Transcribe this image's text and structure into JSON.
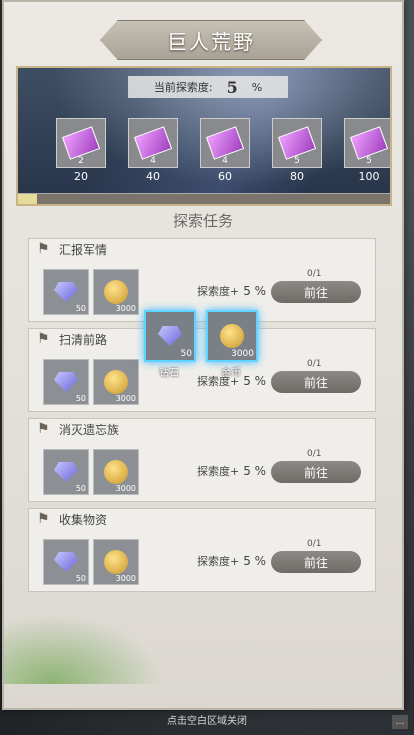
{
  "title": "巨人荒野",
  "explore": {
    "label": "当前探索度:",
    "value": "5",
    "unit": "%",
    "progress_fraction": 0.05
  },
  "milestones": [
    {
      "count": "2",
      "threshold": "20"
    },
    {
      "count": "4",
      "threshold": "40"
    },
    {
      "count": "4",
      "threshold": "60"
    },
    {
      "count": "5",
      "threshold": "80"
    },
    {
      "count": "5",
      "threshold": "100"
    }
  ],
  "section_title": "探索任务",
  "tasks": [
    {
      "name": "汇报军情",
      "gem_qty": "50",
      "coin_qty": "3000",
      "rate_label": "探索度+",
      "rate_value": "5 %",
      "progress": "0/1",
      "button": "前往"
    },
    {
      "name": "扫清前路",
      "gem_qty": "50",
      "coin_qty": "3000",
      "rate_label": "探索度+",
      "rate_value": "5 %",
      "progress": "0/1",
      "button": "前往"
    },
    {
      "name": "消灭遗忘族",
      "gem_qty": "50",
      "coin_qty": "3000",
      "rate_label": "探索度+",
      "rate_value": "5 %",
      "progress": "0/1",
      "button": "前往"
    },
    {
      "name": "收集物资",
      "gem_qty": "50",
      "coin_qty": "3000",
      "rate_label": "探索度+",
      "rate_value": "5 %",
      "progress": "0/1",
      "button": "前往"
    }
  ],
  "popup": [
    {
      "name": "钻石",
      "qty": "50"
    },
    {
      "name": "金币",
      "qty": "3000"
    }
  ],
  "footer": "点击空白区域关闭"
}
